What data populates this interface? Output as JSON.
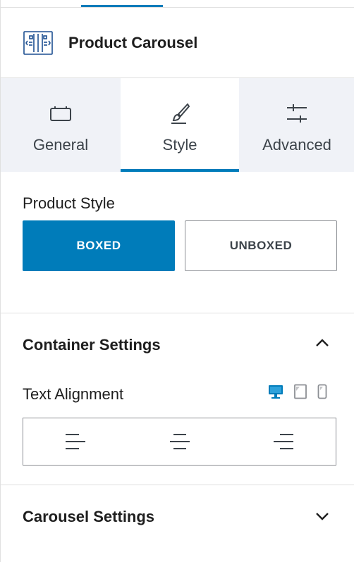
{
  "block": {
    "title": "Product Carousel",
    "icon": "product-carousel-icon"
  },
  "tabs": [
    {
      "label": "General",
      "icon": "layout-icon",
      "active": false
    },
    {
      "label": "Style",
      "icon": "brush-icon",
      "active": true
    },
    {
      "label": "Advanced",
      "icon": "sliders-icon",
      "active": false
    }
  ],
  "product_style": {
    "label": "Product Style",
    "options": [
      "BOXED",
      "UNBOXED"
    ],
    "selected": "BOXED"
  },
  "container_settings": {
    "title": "Container Settings",
    "expanded": true,
    "text_alignment": {
      "label": "Text Alignment",
      "devices": [
        "desktop-icon",
        "tablet-icon",
        "mobile-icon"
      ],
      "active_device": "desktop",
      "options": [
        "align-left-icon",
        "align-center-icon",
        "align-right-icon"
      ]
    }
  },
  "carousel_settings": {
    "title": "Carousel Settings",
    "expanded": false
  },
  "colors": {
    "accent": "#007cba",
    "tab_bg": "#f0f2f7",
    "border": "#8c8f94"
  }
}
